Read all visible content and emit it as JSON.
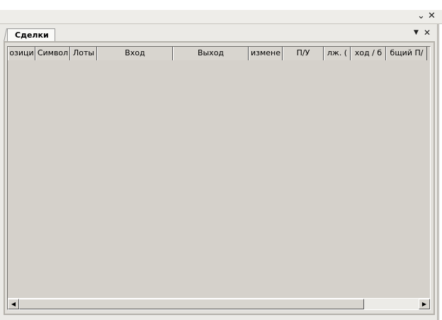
{
  "window": {
    "menu_icon": "pin-menu-icon",
    "close_icon": "close-icon"
  },
  "panel": {
    "tab_label": "Сделки"
  },
  "table": {
    "columns": [
      "озици",
      "Символ",
      "Лоты",
      "Вход",
      "Выход",
      "измене",
      "П/У",
      "лж. (",
      "ход / б",
      "бщий П/"
    ]
  }
}
